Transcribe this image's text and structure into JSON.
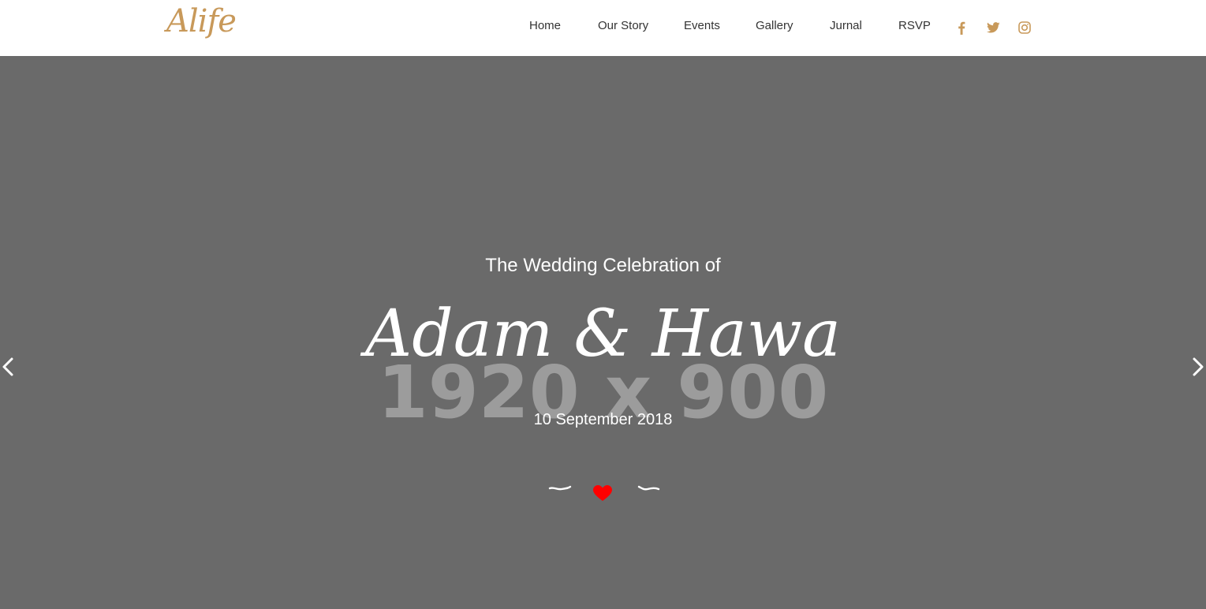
{
  "header": {
    "logo_text": "Alife",
    "nav": [
      {
        "label": "Home"
      },
      {
        "label": "Our Story"
      },
      {
        "label": "Events"
      },
      {
        "label": "Gallery"
      },
      {
        "label": "Jurnal"
      },
      {
        "label": "RSVP"
      }
    ],
    "social_icons": [
      "facebook-icon",
      "twitter-icon",
      "instagram-icon"
    ],
    "accent_color": "#c8995a"
  },
  "hero": {
    "placeholder_text": "1920 x 900",
    "subtitle": "The Wedding Celebration of",
    "names": "Adam & Hawa",
    "date": "10 September 2018",
    "background_color": "#6a6a6a",
    "heart_color": "#ff0000",
    "prev_icon": "chevron-left-icon",
    "next_icon": "chevron-right-icon"
  }
}
